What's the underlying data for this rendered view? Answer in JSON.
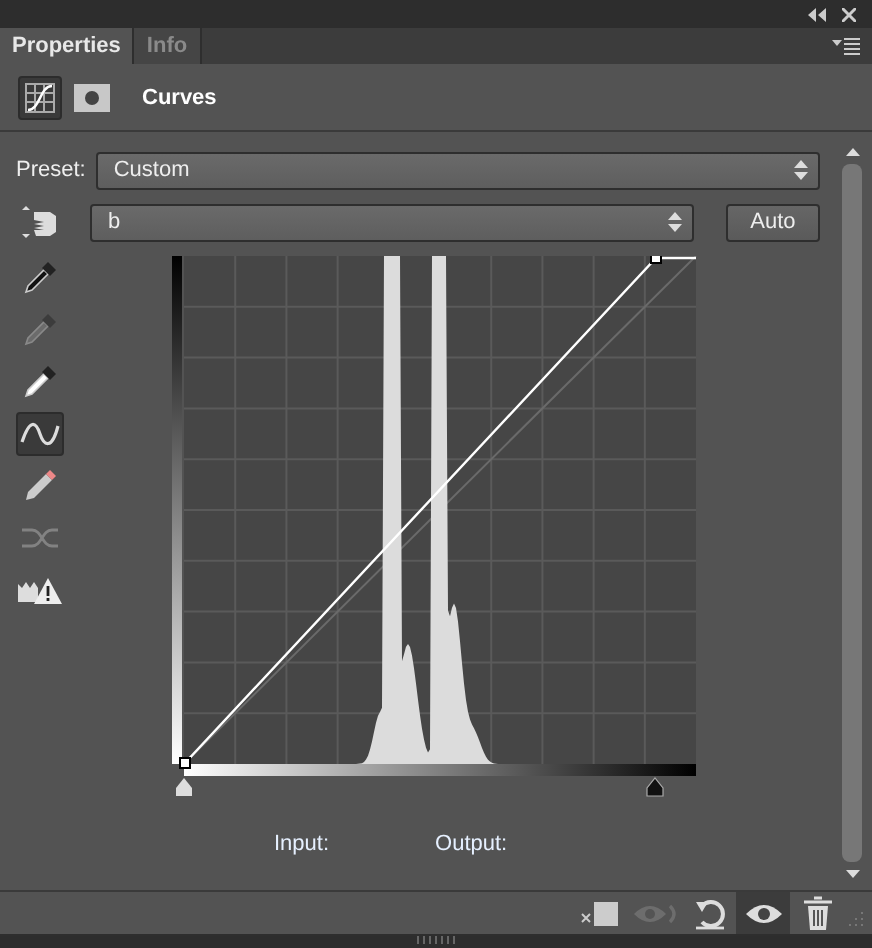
{
  "tabs": [
    {
      "label": "Properties",
      "selected": true
    },
    {
      "label": "Info",
      "selected": false
    }
  ],
  "header": {
    "title": "Curves",
    "modes": [
      {
        "kind": "adjustment",
        "selected": true
      },
      {
        "kind": "mask",
        "selected": false
      }
    ]
  },
  "preset": {
    "label": "Preset:",
    "value": "Custom"
  },
  "channel": {
    "value": "b"
  },
  "auto_button": "Auto",
  "tools": [
    {
      "kind": "on-image",
      "selected": false,
      "disabled": false
    },
    {
      "kind": "black-point",
      "selected": false,
      "disabled": false
    },
    {
      "kind": "gray-point",
      "selected": false,
      "disabled": true
    },
    {
      "kind": "white-point",
      "selected": false,
      "disabled": false
    },
    {
      "kind": "curve-points",
      "selected": true,
      "disabled": false
    },
    {
      "kind": "pencil",
      "selected": false,
      "disabled": false
    },
    {
      "kind": "smooth",
      "selected": false,
      "disabled": true
    },
    {
      "kind": "clipping",
      "selected": false,
      "disabled": false
    }
  ],
  "input_sliders": [
    {
      "kind": "shadows",
      "level": 0
    },
    {
      "kind": "highlights",
      "level": 0.92
    }
  ],
  "readout": {
    "input_label": "Input:",
    "output_label": "Output:"
  },
  "footer_buttons": [
    {
      "kind": "clip",
      "disabled": false,
      "selected": false
    },
    {
      "kind": "view-previous",
      "disabled": true,
      "selected": false
    },
    {
      "kind": "reset",
      "disabled": false,
      "selected": false
    },
    {
      "kind": "visibility",
      "disabled": false,
      "selected": true
    },
    {
      "kind": "delete",
      "disabled": false,
      "selected": false
    }
  ]
}
